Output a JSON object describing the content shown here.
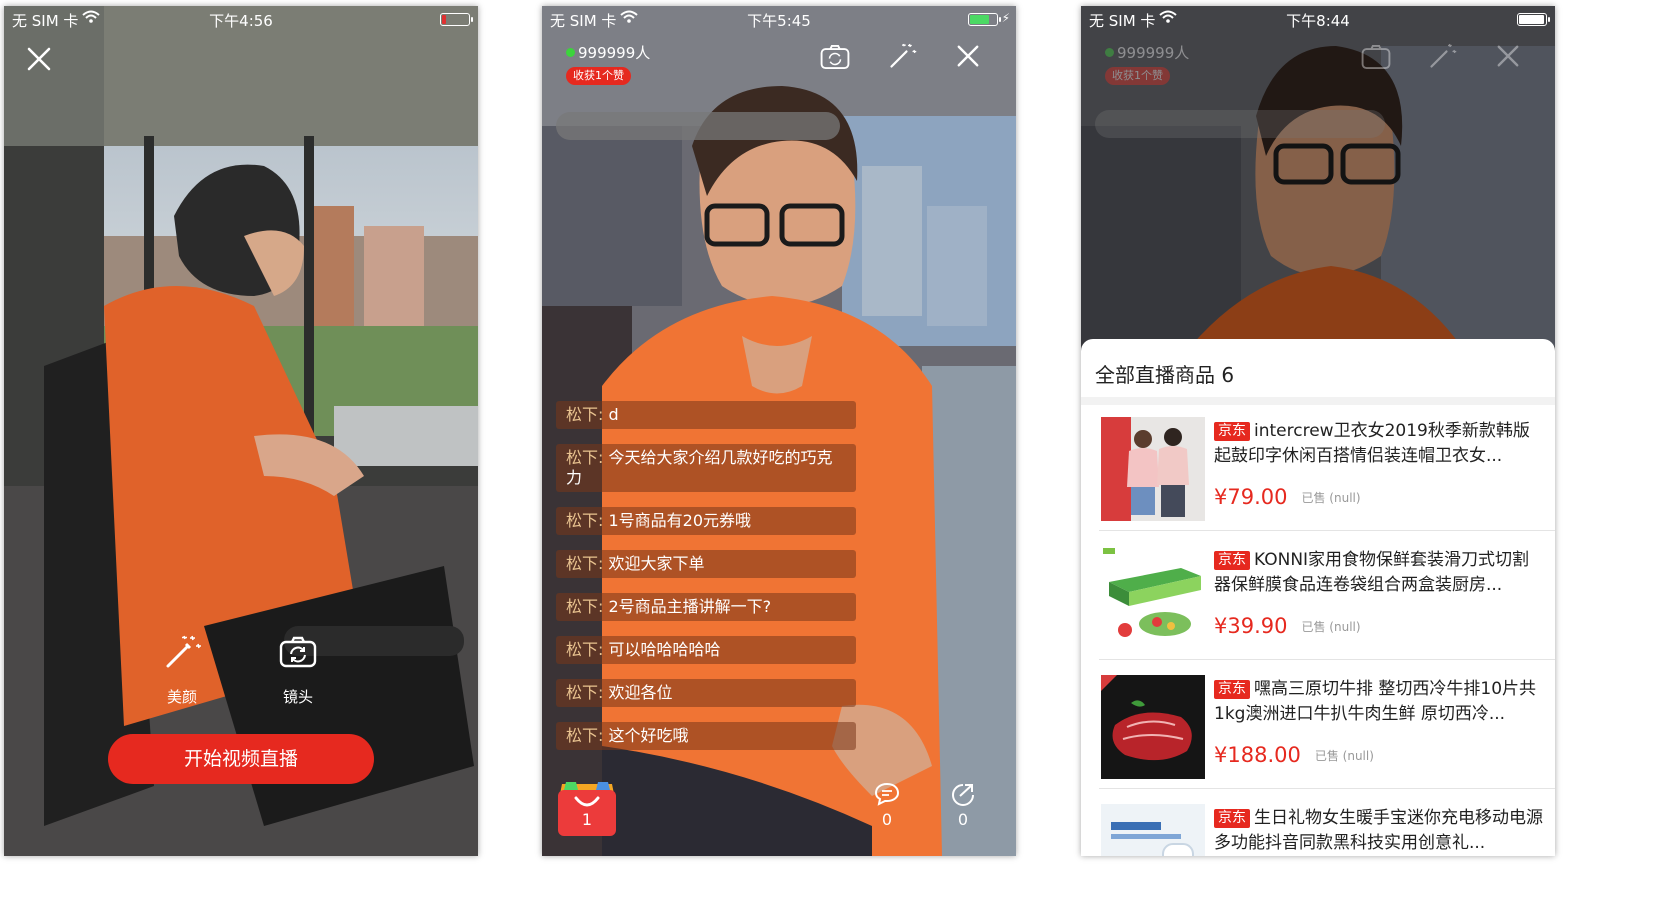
{
  "screens": [
    {
      "status": {
        "carrier": "无 SIM 卡",
        "time": "下午4:56",
        "battery_color": "#e03131",
        "battery_level": 0.15
      },
      "controls": {
        "beauty_label": "美颜",
        "camera_label": "镜头"
      },
      "start_button": "开始视频直播"
    },
    {
      "status": {
        "carrier": "无 SIM 卡",
        "time": "下午5:45",
        "battery_color": "#4cd964",
        "battery_level": 0.75
      },
      "viewers": "999999人",
      "likes": "收获1个赞",
      "messages": [
        {
          "user": "松下:",
          "text": "d"
        },
        {
          "user": "松下:",
          "text": "今天给大家介绍几款好吃的巧克力"
        },
        {
          "user": "松下:",
          "text": "1号商品有20元券哦"
        },
        {
          "user": "松下:",
          "text": "欢迎大家下单"
        },
        {
          "user": "松下:",
          "text": "2号商品主播讲解一下?"
        },
        {
          "user": "松下:",
          "text": "可以哈哈哈哈哈"
        },
        {
          "user": "松下:",
          "text": "欢迎各位"
        },
        {
          "user": "松下:",
          "text": "这个好吃哦"
        }
      ],
      "cart_count": "1",
      "comment_count": "0",
      "share_count": "0"
    },
    {
      "status": {
        "carrier": "无 SIM 卡",
        "time": "下午8:44",
        "battery_color": "#ffffff",
        "battery_level": 1.0
      },
      "viewers": "999999人",
      "likes": "收获1个赞",
      "sheet": {
        "title": "全部直播商品 6",
        "products": [
          {
            "tag": "京东",
            "title": "intercrew卫衣女2019秋季新款韩版起鼓印字休闲百搭情侣装连帽卫衣女...",
            "price": "¥79.00",
            "sold": "已售 (null)"
          },
          {
            "tag": "京东",
            "title": "KONNI家用食物保鲜套装滑刀式切割器保鲜膜食品连卷袋组合两盒装厨房...",
            "price": "¥39.90",
            "sold": "已售 (null)"
          },
          {
            "tag": "京东",
            "title": "嘿高三原切牛排 整切西冷牛排10片共1kg澳洲进口牛扒牛肉生鲜 原切西冷...",
            "price": "¥188.00",
            "sold": "已售 (null)"
          },
          {
            "tag": "京东",
            "title": "生日礼物女生暖手宝迷你充电移动电源多功能抖音同款黑科技实用创意礼...",
            "price": "",
            "sold": ""
          }
        ]
      }
    }
  ]
}
